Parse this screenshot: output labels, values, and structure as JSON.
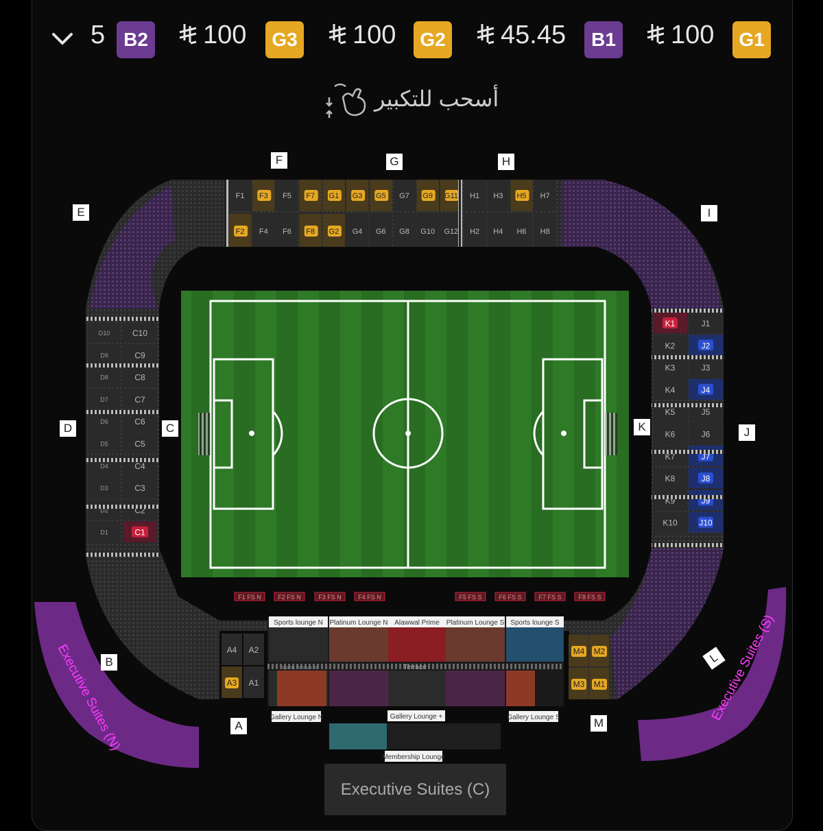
{
  "header": {
    "quantity": "5",
    "tiers": [
      {
        "badge": "B2",
        "price": "",
        "color": "#6c3b92"
      },
      {
        "badge": "G3",
        "price": "100",
        "color": "#e6a823"
      },
      {
        "badge": "G2",
        "price": "100",
        "color": "#e6a823"
      },
      {
        "badge": "B1",
        "price": "45.45",
        "color": "#6c3b92"
      },
      {
        "badge": "G1",
        "price": "100",
        "color": "#e6a823"
      }
    ]
  },
  "hint": {
    "text": "أسحب للتكبير",
    "icon": "pinch-zoom-icon"
  },
  "stands": {
    "F": "F",
    "G": "G",
    "H": "H",
    "E": "E",
    "I": "I",
    "D": "D",
    "C": "C",
    "K": "K",
    "J": "J",
    "B": "B",
    "A": "A",
    "M": "M",
    "L": "L"
  },
  "sections": {
    "north_top": [
      "F1",
      "F3",
      "F5",
      "F7",
      "G1",
      "G3",
      "G5",
      "G7",
      "G9",
      "G11",
      "H1",
      "H3",
      "H5",
      "H7"
    ],
    "north_bottom": [
      "F2",
      "F4",
      "F6",
      "F8",
      "G2",
      "G4",
      "G6",
      "G8",
      "G10",
      "G12",
      "H2",
      "H4",
      "H6",
      "H8"
    ],
    "west_outer": [
      "D10",
      "D9",
      "D8",
      "D7",
      "D6",
      "D5",
      "D4",
      "D3",
      "D2",
      "D1"
    ],
    "west_inner": [
      "C10",
      "C9",
      "C8",
      "C7",
      "C6",
      "C5",
      "C4",
      "C3",
      "C2",
      "C1"
    ],
    "east_inner": [
      "K1",
      "K2",
      "K3",
      "K4",
      "K5",
      "K6",
      "K7",
      "K8",
      "K9",
      "K10"
    ],
    "east_outer": [
      "J1",
      "J2",
      "J3",
      "J4",
      "J5",
      "J6",
      "J7",
      "J8",
      "J9",
      "J10"
    ],
    "south_a": [
      "A4",
      "A2",
      "A3",
      "A1"
    ],
    "south_m": [
      "M4",
      "M2",
      "M3",
      "M1"
    ],
    "fs_north": [
      "F1 FS N",
      "F2 FS N",
      "F3 FS N",
      "F4 FS N"
    ],
    "fs_south": [
      "F5 FS S",
      "F6 FS S",
      "F7 FS S",
      "F8 FS S"
    ]
  },
  "lounges": {
    "sports_n": "Sports lounge N",
    "platinum_n": "Platinum Lounge N",
    "alawwal": "Alawwal Prime",
    "platinum_s": "Platinum Lounge S",
    "sports_s": "Sports lounge S",
    "terrace": "Terrace",
    "sports_terrace_n": "Sports Terrace N",
    "gallery_n": "Gallery Lounge N",
    "gallery_plus": "Gallery Lounge +",
    "gallery_s": "Gallery Lounge S",
    "membership": "Membership Lounge"
  },
  "executive": {
    "north": "Executive Suites (N)",
    "south": "Executive Suites (S)",
    "center": "Executive Suites (C)"
  },
  "colors": {
    "gold": "#e6a823",
    "purple": "#6c3b92",
    "blue": "#2a4fd0",
    "red": "#c8203c",
    "pitch": "#2f7d2a"
  }
}
